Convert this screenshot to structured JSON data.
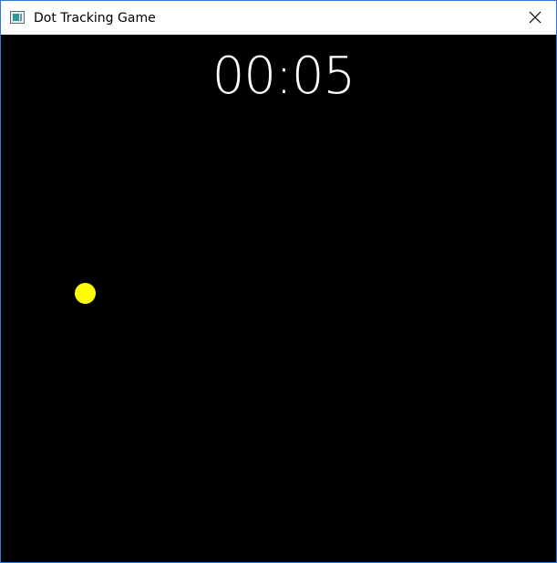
{
  "window": {
    "title": "Dot Tracking Game",
    "icon": "app-window-icon",
    "close_icon": "close-icon"
  },
  "game": {
    "timer": "00:05",
    "background_color": "#000000",
    "dot_color": "#ffff00"
  }
}
